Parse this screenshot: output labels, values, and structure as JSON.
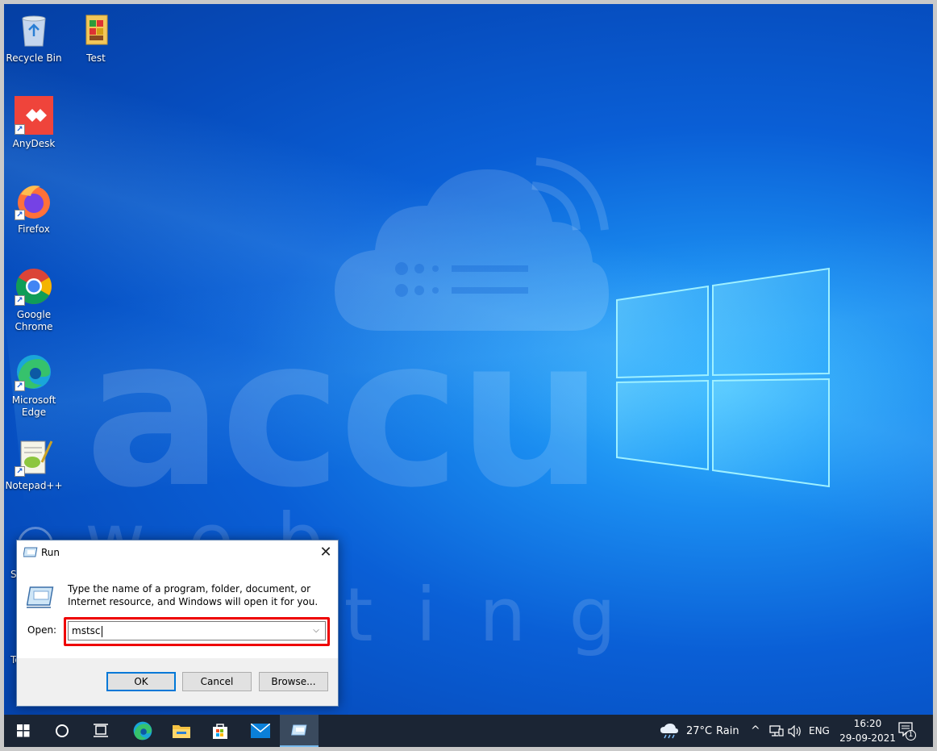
{
  "desktop": {
    "icons": [
      {
        "label": "Recycle Bin"
      },
      {
        "label": "Test"
      },
      {
        "label": "AnyDesk"
      },
      {
        "label": "Firefox"
      },
      {
        "label": "Google Chrome"
      },
      {
        "label": "Microsoft Edge"
      },
      {
        "label": "Notepad++"
      }
    ],
    "partial_icons": {
      "first": "Sc",
      "second": "Te"
    },
    "watermark": {
      "brand": "accu",
      "sub": "web hosting"
    }
  },
  "run_dialog": {
    "title": "Run",
    "close_glyph": "✕",
    "description": "Type the name of a program, folder, document, or Internet resource, and Windows will open it for you.",
    "open_label": "Open:",
    "input_value": "mstsc",
    "dropdown_glyph": "⌵",
    "buttons": {
      "ok": "OK",
      "cancel": "Cancel",
      "browse": "Browse..."
    },
    "highlight_color": "#e00000"
  },
  "taskbar": {
    "weather": {
      "temp": "27°C",
      "condition": "Rain"
    },
    "language": "ENG",
    "clock": {
      "time": "16:20",
      "date": "29-09-2021"
    },
    "notification_count": "1",
    "tray_chevron": "^"
  },
  "colors": {
    "taskbar_bg": "#1b2534",
    "accent": "#0078d7",
    "desktop_blue": "#0a5fd6"
  }
}
